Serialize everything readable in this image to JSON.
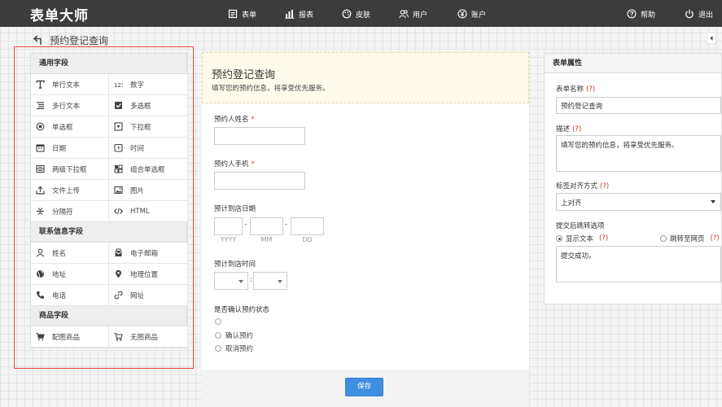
{
  "app": {
    "brand": "表单大师"
  },
  "nav": {
    "items": [
      {
        "label": "表单",
        "icon": "list-icon"
      },
      {
        "label": "报表",
        "icon": "bar-chart-icon"
      },
      {
        "label": "皮肤",
        "icon": "palette-icon"
      },
      {
        "label": "用户",
        "icon": "users-icon"
      },
      {
        "label": "账户",
        "icon": "yen-icon"
      }
    ],
    "help": "帮助",
    "logout": "退出"
  },
  "page": {
    "title": "预约登记查询"
  },
  "palette": {
    "groups": [
      {
        "title": "通用字段",
        "fields": [
          {
            "label": "单行文本",
            "icon": "text-t-icon"
          },
          {
            "label": "数字",
            "icon": "number-icon"
          },
          {
            "label": "多行文本",
            "icon": "paragraph-icon"
          },
          {
            "label": "多选框",
            "icon": "checkbox-icon"
          },
          {
            "label": "单选框",
            "icon": "radio-icon"
          },
          {
            "label": "下拉框",
            "icon": "dropdown-icon"
          },
          {
            "label": "日期",
            "icon": "calendar-icon"
          },
          {
            "label": "时间",
            "icon": "clock-icon"
          },
          {
            "label": "两级下拉框",
            "icon": "two-level-dropdown-icon"
          },
          {
            "label": "组合单选框",
            "icon": "group-radio-icon"
          },
          {
            "label": "文件上传",
            "icon": "upload-icon"
          },
          {
            "label": "图片",
            "icon": "image-icon"
          },
          {
            "label": "分隔符",
            "icon": "separator-icon"
          },
          {
            "label": "HTML",
            "icon": "code-icon"
          }
        ]
      },
      {
        "title": "联系信息字段",
        "fields": [
          {
            "label": "姓名",
            "icon": "user-icon"
          },
          {
            "label": "电子邮箱",
            "icon": "mail-icon"
          },
          {
            "label": "地址",
            "icon": "globe-icon"
          },
          {
            "label": "地理位置",
            "icon": "map-pin-icon"
          },
          {
            "label": "电话",
            "icon": "phone-icon"
          },
          {
            "label": "网址",
            "icon": "link-icon"
          }
        ]
      },
      {
        "title": "商品字段",
        "fields": [
          {
            "label": "配图商品",
            "icon": "cart-filled-icon"
          },
          {
            "label": "无图商品",
            "icon": "cart-outline-icon"
          }
        ]
      }
    ]
  },
  "form": {
    "title": "预约登记查询",
    "description": "填写您的预约信息，将享受优先服务。",
    "name_label": "预约人姓名",
    "phone_label": "预约人手机",
    "required_mark": "*",
    "date_label": "预计到店日期",
    "date_sep": "-",
    "date_captions": [
      "YYYY",
      "MM",
      "DD"
    ],
    "time_label": "预计到店时间",
    "time_sep": ":",
    "status_label": "是否确认预约状态",
    "status_options": [
      "",
      "确认预约",
      "取消预约"
    ],
    "save_label": "保存"
  },
  "props": {
    "header": "表单属性",
    "hint_mark": "(?)",
    "name_label": "表单名称",
    "name_value": "预约登记查询",
    "desc_label": "描述",
    "desc_value": "填写您的预约信息，将享受优先服务。",
    "align_label": "标签对齐方式",
    "align_value": "上对齐",
    "after_submit_label": "提交后跳转选项",
    "option_text": "显示文本",
    "option_url": "跳转至网页",
    "selected_option": "显示文本",
    "success_text": "提交成功。"
  }
}
